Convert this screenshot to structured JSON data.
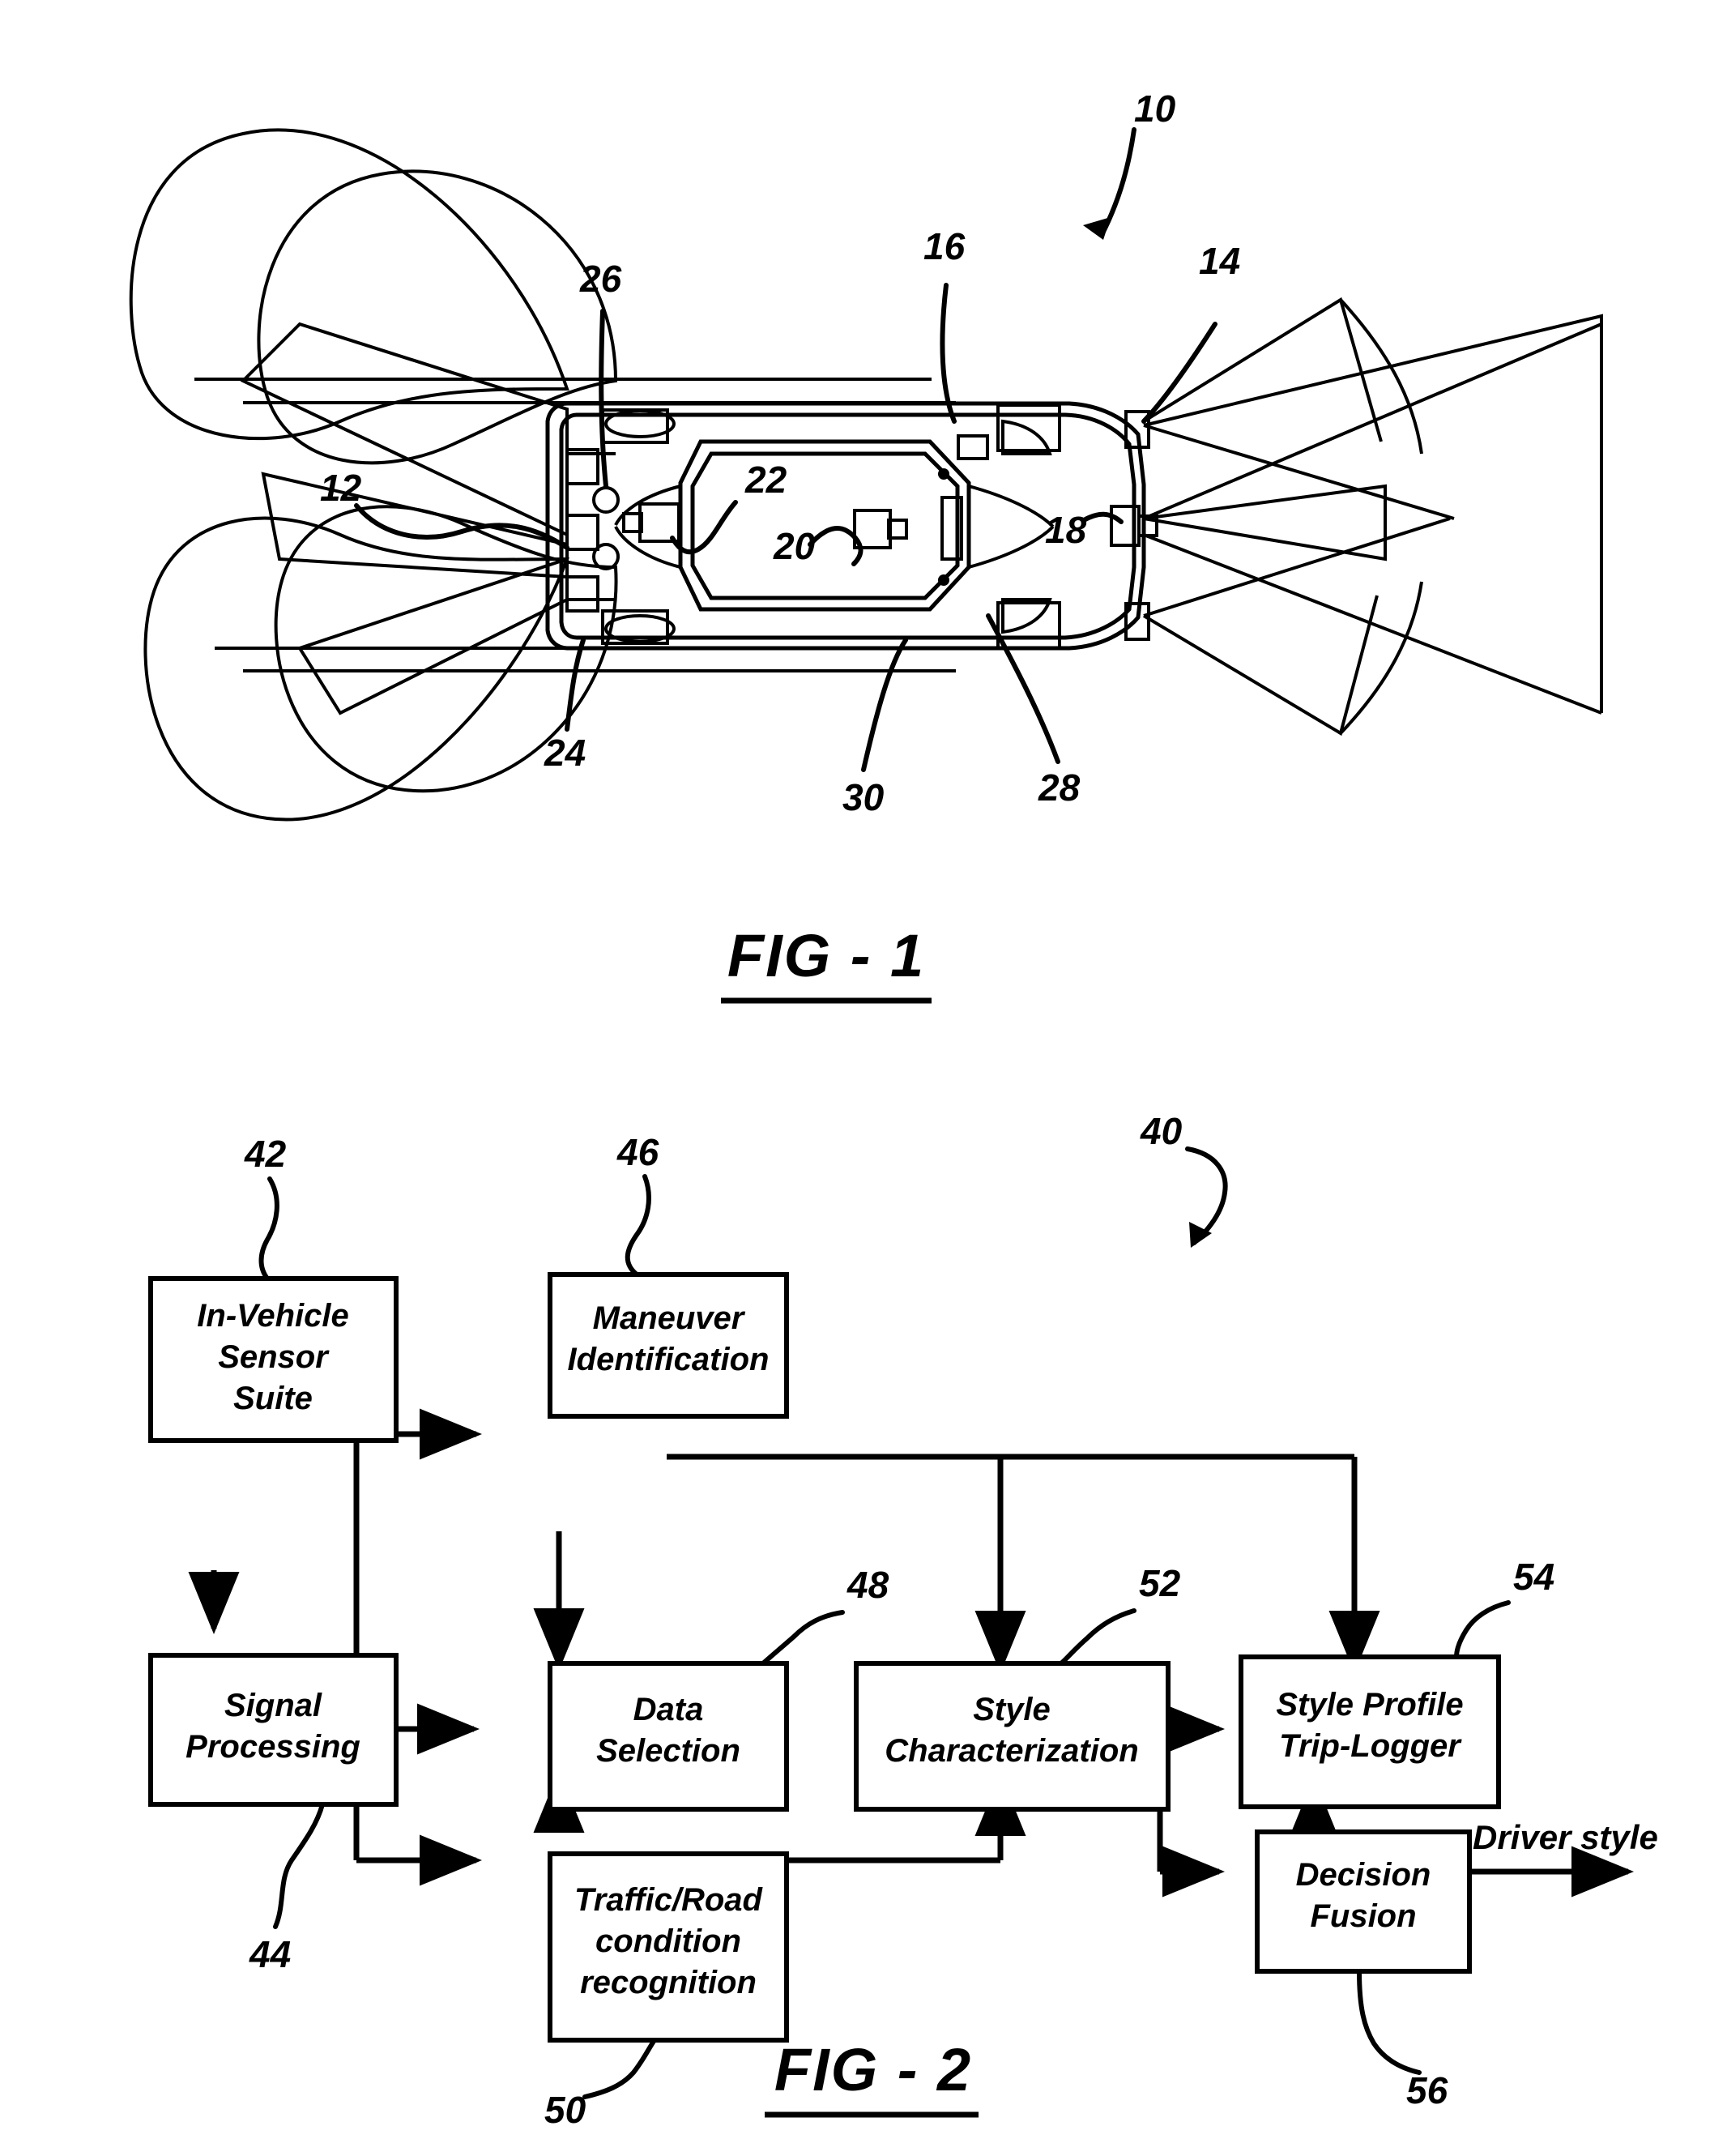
{
  "document": {
    "type": "patent-drawing-sheet",
    "figures": [
      {
        "id": "fig1",
        "caption": "FIG - 1"
      },
      {
        "id": "fig2",
        "caption": "FIG - 2"
      }
    ]
  },
  "fig1": {
    "caption": "FIG - 1",
    "title_ref": "10",
    "reference_numerals": [
      {
        "id": "10",
        "label": "10"
      },
      {
        "id": "12",
        "label": "12"
      },
      {
        "id": "14",
        "label": "14"
      },
      {
        "id": "16",
        "label": "16"
      },
      {
        "id": "18",
        "label": "18"
      },
      {
        "id": "20",
        "label": "20"
      },
      {
        "id": "22",
        "label": "22"
      },
      {
        "id": "24",
        "label": "24"
      },
      {
        "id": "26",
        "label": "26"
      },
      {
        "id": "28",
        "label": "28"
      },
      {
        "id": "30",
        "label": "30"
      }
    ]
  },
  "fig2": {
    "caption": "FIG - 2",
    "system_ref": "40",
    "blocks": [
      {
        "id": "sensor_suite",
        "ref": "42",
        "lines": [
          "In-Vehicle",
          "Sensor",
          "Suite"
        ]
      },
      {
        "id": "signal_processing",
        "ref": "44",
        "lines": [
          "Signal",
          "Processing"
        ]
      },
      {
        "id": "maneuver_identification",
        "ref": "46",
        "lines": [
          "Maneuver",
          "Identification"
        ]
      },
      {
        "id": "data_selection",
        "ref": "48",
        "lines": [
          "Data",
          "Selection"
        ]
      },
      {
        "id": "traffic_road",
        "ref": "50",
        "lines": [
          "Traffic/Road",
          "condition",
          "recognition"
        ]
      },
      {
        "id": "style_characterization",
        "ref": "52",
        "lines": [
          "Style",
          "Characterization"
        ]
      },
      {
        "id": "style_profile_logger",
        "ref": "54",
        "lines": [
          "Style Profile",
          "Trip-Logger"
        ]
      },
      {
        "id": "decision_fusion",
        "ref": "56",
        "lines": [
          "Decision",
          "Fusion"
        ]
      }
    ],
    "output_label": "Driver style",
    "reference_numerals": [
      {
        "id": "40",
        "label": "40"
      },
      {
        "id": "42",
        "label": "42"
      },
      {
        "id": "44",
        "label": "44"
      },
      {
        "id": "46",
        "label": "46"
      },
      {
        "id": "48",
        "label": "48"
      },
      {
        "id": "50",
        "label": "50"
      },
      {
        "id": "52",
        "label": "52"
      },
      {
        "id": "54",
        "label": "54"
      },
      {
        "id": "56",
        "label": "56"
      }
    ]
  },
  "colors": {
    "ink": "#000000",
    "paper": "#ffffff"
  }
}
